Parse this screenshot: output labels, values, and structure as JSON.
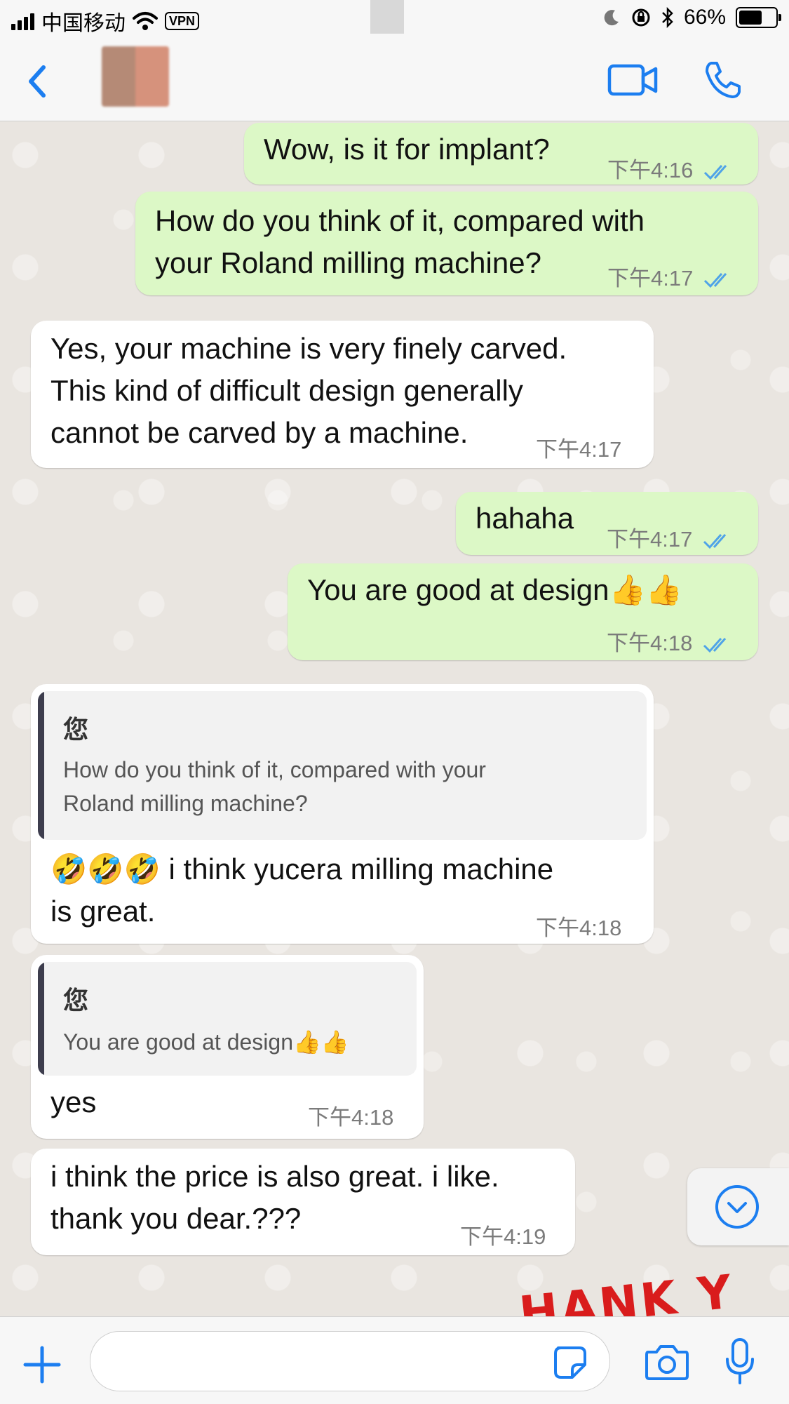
{
  "status_bar": {
    "carrier": "中国移动",
    "vpn": "VPN",
    "battery": "66%",
    "battery_level": 0.66,
    "icons": [
      "signal-icon",
      "wifi-icon",
      "moon-icon",
      "orientation-lock-icon",
      "bluetooth-icon",
      "battery-icon"
    ]
  },
  "header": {
    "contact_name": "",
    "icons": [
      "back-chevron-icon",
      "video-call-icon",
      "phone-call-icon"
    ]
  },
  "colors": {
    "accent": "#1c7ef0",
    "outgoing_bubble": "#dcf8c6",
    "incoming_bubble": "#ffffff",
    "read_tick": "#4fa3e8"
  },
  "messages": [
    {
      "dir": "out",
      "text": "Wow, is it for implant?",
      "time": "下午4:16",
      "read": true
    },
    {
      "dir": "out",
      "text_lines": [
        "How do you think of it, compared with",
        "your Roland milling machine?"
      ],
      "time": "下午4:17",
      "read": true
    },
    {
      "dir": "in",
      "text_lines": [
        "Yes, your machine is very finely carved.",
        "This kind of difficult design generally",
        "cannot be carved by a machine."
      ],
      "time": "下午4:17"
    },
    {
      "dir": "out",
      "text": "hahaha",
      "time": "下午4:17",
      "read": true
    },
    {
      "dir": "out",
      "text": "You are good at design👍👍",
      "time": "下午4:18",
      "read": true
    },
    {
      "dir": "in",
      "quote_name": "您",
      "quote_lines": [
        "How do you think of it, compared with your",
        "Roland milling machine?"
      ],
      "text_lines": [
        "🤣🤣🤣 i think yucera milling machine",
        "is great."
      ],
      "time": "下午4:18"
    },
    {
      "dir": "in",
      "quote_name": "您",
      "quote_lines": [
        "You are good at design👍👍"
      ],
      "text": "yes",
      "time": "下午4:18"
    },
    {
      "dir": "in",
      "text_lines": [
        "i think the price is also great. i like.",
        "thank you dear.???"
      ],
      "time": "下午4:19"
    }
  ],
  "sticker_peek_text": "HANK Y",
  "input_bar": {
    "placeholder": "",
    "icons": [
      "plus-icon",
      "sticker-icon",
      "camera-icon",
      "microphone-icon"
    ]
  },
  "scroll_down_icon": "chevron-down-circle-icon"
}
